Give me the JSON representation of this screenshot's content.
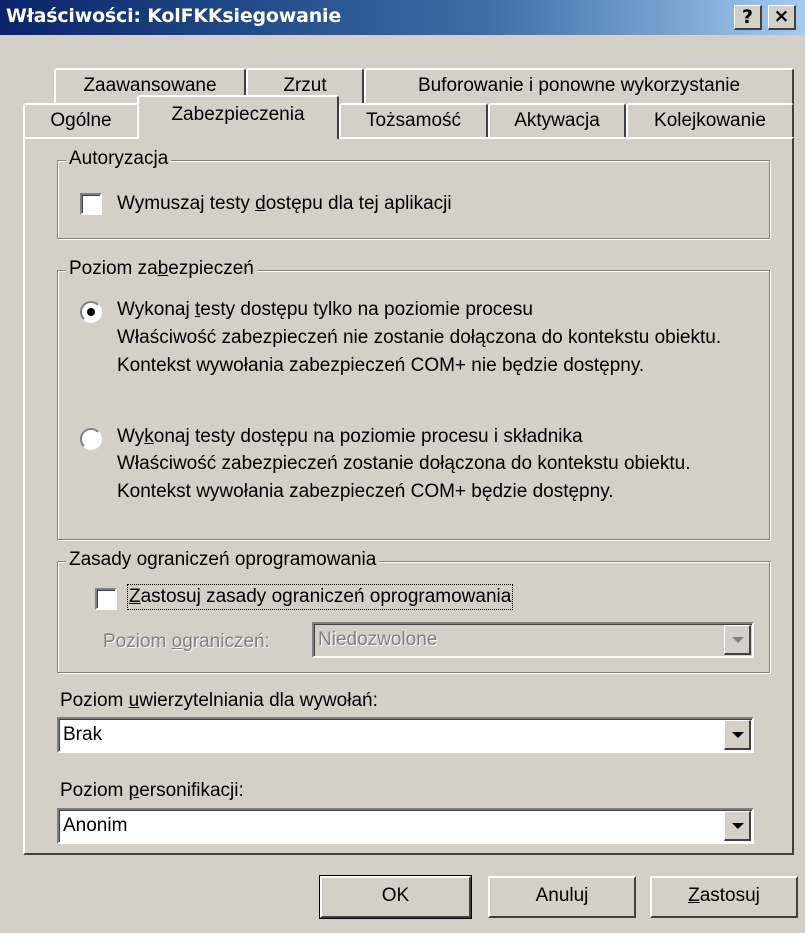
{
  "window": {
    "title": "Właściwości: KolFKKsiegowanie",
    "help_label": "?",
    "close_label": "×"
  },
  "tabs_row1": [
    {
      "label": "Zaawansowane"
    },
    {
      "label": "Zrzut"
    },
    {
      "label": "Buforowanie i ponowne wykorzystanie"
    }
  ],
  "tabs_row2": [
    {
      "label": "Ogólne"
    },
    {
      "label": "Zabezpieczenia",
      "active": true
    },
    {
      "label": "Tożsamość"
    },
    {
      "label": "Aktywacja"
    },
    {
      "label": "Kolejkowanie"
    }
  ],
  "authorization": {
    "legend": "Autoryzacja",
    "checkbox_pre": "Wymuszaj testy ",
    "checkbox_mnemonic": "d",
    "checkbox_post": "ostępu dla tej aplikacji",
    "checked": false
  },
  "security_level": {
    "legend_pre": "Poziom za",
    "legend_mnemonic": "b",
    "legend_post": "ezpieczeń",
    "option1": {
      "title_pre": "Wykonaj ",
      "title_mnemonic": "t",
      "title_post": "esty dostępu tylko na poziomie procesu",
      "description": "Właściwość zabezpieczeń nie zostanie dołączona do kontekstu obiektu. Kontekst wywołania zabezpieczeń COM+ nie będzie dostępny.",
      "selected": true
    },
    "option2": {
      "title_pre": "Wy",
      "title_mnemonic": "k",
      "title_post": "onaj testy dostępu na poziomie procesu i składnika",
      "description": "Właściwość zabezpieczeń zostanie dołączona do kontekstu obiektu. Kontekst wywołania zabezpieczeń COM+ będzie dostępny.",
      "selected": false
    }
  },
  "software_restriction": {
    "legend": "Zasady ograniczeń oprogramowania",
    "checkbox_mnemonic": "Z",
    "checkbox_post": "astosuj zasady ograniczeń oprogramowania",
    "checked": false,
    "level_label_pre": "Poziom ",
    "level_label_mnemonic": "o",
    "level_label_post": "graniczeń:",
    "level_value": "Niedozwolone"
  },
  "auth_level": {
    "label_pre": "Poziom ",
    "label_mnemonic": "u",
    "label_post": "wierzytelniania dla wywołań:",
    "value": "Brak"
  },
  "impersonation": {
    "label_pre": "Poziom ",
    "label_mnemonic": "p",
    "label_post": "ersonifikacji:",
    "value": "Anonim"
  },
  "buttons": {
    "ok": "OK",
    "cancel": "Anuluj",
    "apply_mnemonic": "Z",
    "apply_post": "astosuj"
  }
}
